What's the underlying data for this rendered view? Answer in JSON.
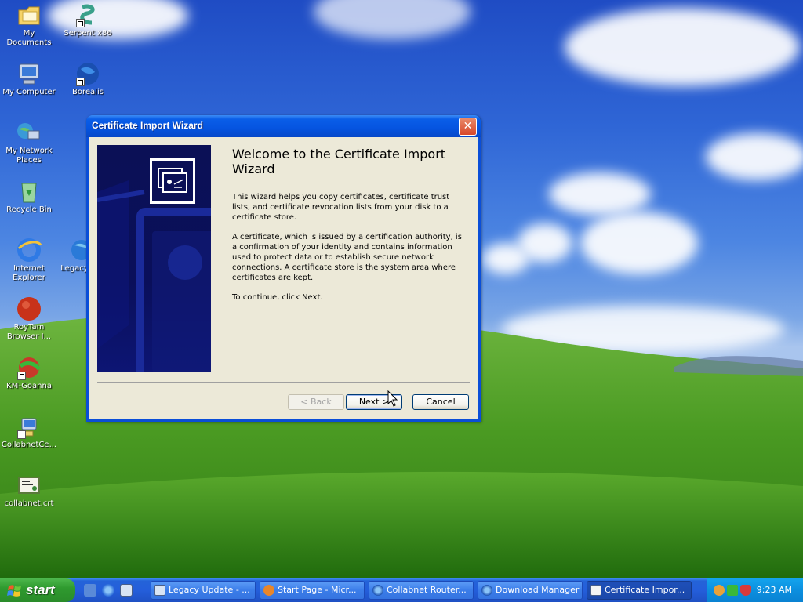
{
  "desktop": {
    "icons": [
      {
        "label": "My Documents",
        "icon": "folder-icon"
      },
      {
        "label": "Serpent x86",
        "icon": "serpent-icon"
      },
      {
        "label": "My Computer",
        "icon": "computer-icon"
      },
      {
        "label": "Borealis",
        "icon": "globe-icon"
      },
      {
        "label": "My Network Places",
        "icon": "network-icon"
      },
      {
        "label": "Recycle Bin",
        "icon": "recycle-bin-icon"
      },
      {
        "label": "Internet Explorer",
        "icon": "ie-icon"
      },
      {
        "label": "Legacy",
        "icon": "legacy-icon"
      },
      {
        "label": "RoyTam Browser I...",
        "icon": "roytam-icon"
      },
      {
        "label": "KM-Goanna",
        "icon": "km-goanna-icon"
      },
      {
        "label": "CollabnetCe...",
        "icon": "collabnet-cert-icon"
      },
      {
        "label": "collabnet.crt",
        "icon": "certificate-file-icon"
      }
    ]
  },
  "wizard": {
    "title": "Certificate Import Wizard",
    "close_glyph": "✕",
    "heading": "Welcome to the Certificate Import Wizard",
    "paragraph1": "This wizard helps you copy certificates, certificate trust lists, and certificate revocation lists from your disk to a certificate store.",
    "paragraph2": "A certificate, which is issued by a certification authority, is a confirmation of your identity and contains information used to protect data or to establish secure network connections. A certificate store is the system area where certificates are kept.",
    "paragraph3": "To continue, click Next.",
    "back_label": "< Back",
    "next_label": "Next >",
    "cancel_label": "Cancel"
  },
  "taskbar": {
    "start_label": "start",
    "tasks": [
      {
        "label": "Legacy Update - ...",
        "icon": "legacy-update-icon"
      },
      {
        "label": "Start Page - Micr...",
        "icon": "browser-icon"
      },
      {
        "label": "Collabnet Router...",
        "icon": "globe-icon"
      },
      {
        "label": "Download Manager",
        "icon": "globe-icon"
      },
      {
        "label": "Certificate Impor...",
        "icon": "certificate-icon"
      }
    ],
    "clock": "9:23 AM"
  },
  "colors": {
    "title_bar": "#0554e0",
    "taskbar": "#245edb",
    "start_button": "#2f9a2f",
    "dialog_bg": "#ece9d8",
    "banner": "#0b1056"
  }
}
